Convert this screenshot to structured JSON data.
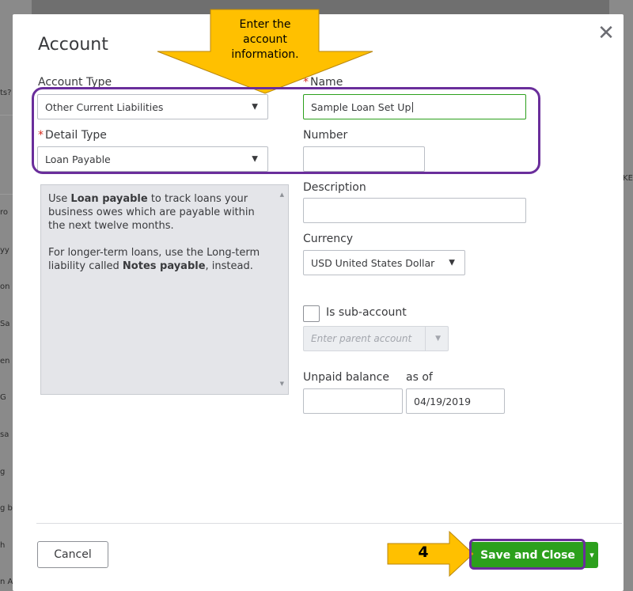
{
  "background": {
    "left_fragments": [
      "ts?",
      "ro",
      "yy",
      "on",
      "Sa",
      "en",
      "G",
      "sa",
      "g",
      "g b",
      "h",
      "n A"
    ],
    "right_fragments": [
      "KE"
    ]
  },
  "dialog": {
    "title": "Account",
    "account_type": {
      "label": "Account Type",
      "value": "Other Current Liabilities"
    },
    "detail_type": {
      "label": "Detail Type",
      "value": "Loan Payable"
    },
    "name": {
      "label": "Name",
      "value": "Sample Loan Set Up"
    },
    "number": {
      "label": "Number",
      "value": ""
    },
    "detail_description": {
      "p1_pre": "Use ",
      "p1_bold": "Loan payable",
      "p1_post": " to track loans your business owes which are payable within the next twelve months.",
      "p2_pre": "For longer-term loans, use the Long-term liability called ",
      "p2_bold": "Notes payable",
      "p2_post": ", instead."
    },
    "description": {
      "label": "Description",
      "value": ""
    },
    "currency": {
      "label": "Currency",
      "value": "USD United States Dollar"
    },
    "sub_account": {
      "label": "Is sub-account",
      "checked": false
    },
    "parent_account": {
      "placeholder": "Enter parent account"
    },
    "unpaid_balance": {
      "label": "Unpaid balance",
      "value": ""
    },
    "as_of": {
      "label": "as of",
      "value": "04/19/2019"
    },
    "cancel_label": "Cancel",
    "save_label": "Save and Close"
  },
  "annotations": {
    "callout_lines": [
      "Enter the",
      "account",
      "information."
    ],
    "step_number": "4",
    "colors": {
      "arrow_fill": "#ffc000",
      "arrow_stroke": "#b8860b",
      "highlight": "#6a2e9b"
    }
  },
  "colors": {
    "accent_green": "#2ca01c",
    "required": "#d52b1e",
    "text": "#393a3d"
  }
}
